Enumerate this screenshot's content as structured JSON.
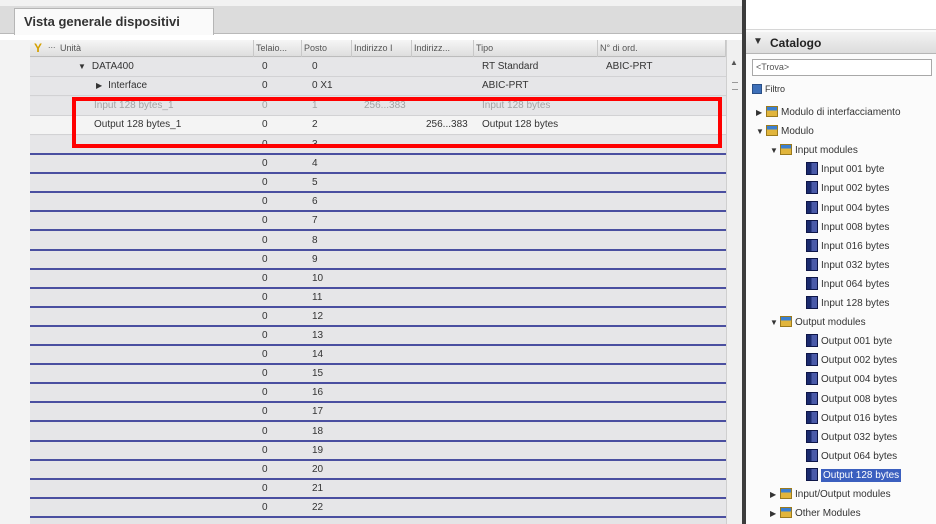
{
  "tab": {
    "title": "Vista generale dispositivi"
  },
  "table": {
    "columns": [
      {
        "label": "Unità"
      },
      {
        "label": "Telaio..."
      },
      {
        "label": "Posto"
      },
      {
        "label": "Indirizzo I"
      },
      {
        "label": "Indirizz..."
      },
      {
        "label": "Tipo"
      },
      {
        "label": "N° di ord."
      }
    ],
    "device": {
      "name": "DATA400",
      "rack": "0",
      "slot": "0",
      "type": "RT Standard",
      "order": "ABIC-PRT"
    },
    "interface": {
      "name": "Interface",
      "rack": "0",
      "slot": "0 X1",
      "type": "ABIC-PRT"
    },
    "input_module": {
      "name": "Input 128 bytes_1",
      "rack": "0",
      "slot": "1",
      "i_addr": "256...383",
      "type": "Input 128 bytes"
    },
    "output_module": {
      "name": "Output 128 bytes_1",
      "rack": "0",
      "slot": "2",
      "q_addr": "256...383",
      "type": "Output 128 bytes"
    },
    "empty_rows": [
      {
        "rack": "0",
        "slot": "3"
      },
      {
        "rack": "0",
        "slot": "4"
      },
      {
        "rack": "0",
        "slot": "5"
      },
      {
        "rack": "0",
        "slot": "6"
      },
      {
        "rack": "0",
        "slot": "7"
      },
      {
        "rack": "0",
        "slot": "8"
      },
      {
        "rack": "0",
        "slot": "9"
      },
      {
        "rack": "0",
        "slot": "10"
      },
      {
        "rack": "0",
        "slot": "11"
      },
      {
        "rack": "0",
        "slot": "12"
      },
      {
        "rack": "0",
        "slot": "13"
      },
      {
        "rack": "0",
        "slot": "14"
      },
      {
        "rack": "0",
        "slot": "15"
      },
      {
        "rack": "0",
        "slot": "16"
      },
      {
        "rack": "0",
        "slot": "17"
      },
      {
        "rack": "0",
        "slot": "18"
      },
      {
        "rack": "0",
        "slot": "19"
      },
      {
        "rack": "0",
        "slot": "20"
      },
      {
        "rack": "0",
        "slot": "21"
      },
      {
        "rack": "0",
        "slot": "22"
      }
    ]
  },
  "catalog": {
    "title": "Catalogo",
    "search_placeholder": "<Trova>",
    "filter_label": "Filtro",
    "tree": {
      "interface_module": "Modulo di interfacciamento",
      "module": "Modulo",
      "input_modules": "Input modules",
      "inputs": [
        "Input 001 byte",
        "Input 002 bytes",
        "Input 004 bytes",
        "Input 008 bytes",
        "Input 016 bytes",
        "Input 032 bytes",
        "Input 064 bytes",
        "Input 128 bytes"
      ],
      "output_modules": "Output modules",
      "outputs": [
        "Output 001 byte",
        "Output 002 bytes",
        "Output 004 bytes",
        "Output 008 bytes",
        "Output 016 bytes",
        "Output 032 bytes",
        "Output 064 bytes",
        "Output 128 bytes"
      ],
      "io_modules": "Input/Output modules",
      "other_modules": "Other Modules"
    }
  },
  "colors": {
    "highlight": "#ff0000",
    "row_separator": "#4a4fa0",
    "selection": "#3b5fbf"
  }
}
